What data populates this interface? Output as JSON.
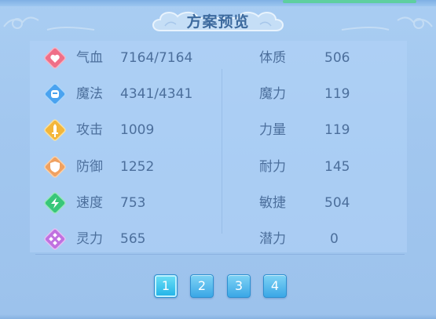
{
  "title": "方案预览",
  "left_stats": [
    {
      "icon": "heart-icon",
      "color": "#e8607a",
      "label": "气血",
      "value": "7164/7164"
    },
    {
      "icon": "magic-icon",
      "color": "#4aa3f0",
      "label": "魔法",
      "value": "4341/4341"
    },
    {
      "icon": "sword-icon",
      "color": "#f3b63a",
      "label": "攻击",
      "value": "1009"
    },
    {
      "icon": "shield-icon",
      "color": "#f0a160",
      "label": "防御",
      "value": "1252"
    },
    {
      "icon": "lightning-icon",
      "color": "#38c779",
      "label": "速度",
      "value": "753"
    },
    {
      "icon": "spirit-icon",
      "color": "#c071e0",
      "label": "灵力",
      "value": "565"
    }
  ],
  "right_stats": [
    {
      "label": "体质",
      "value": "506"
    },
    {
      "label": "魔力",
      "value": "119"
    },
    {
      "label": "力量",
      "value": "119"
    },
    {
      "label": "耐力",
      "value": "145"
    },
    {
      "label": "敏捷",
      "value": "504"
    },
    {
      "label": "潜力",
      "value": "0"
    }
  ],
  "pages": [
    "1",
    "2",
    "3",
    "4"
  ],
  "active_page": "1"
}
